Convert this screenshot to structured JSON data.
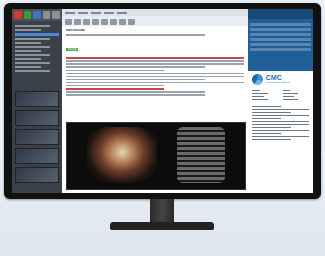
{
  "brand": {
    "logo_text": "CMC",
    "logo_subtitle": "Comprehensive Medical",
    "accent_color": "#1f66a9"
  },
  "report": {
    "section_label": "PROCEDURE",
    "highlight_label": "Normal",
    "highlight_color": "#4caf50"
  },
  "images": {
    "scan_left": "ct-chest-3d-render",
    "scan_right": "spine-sagittal-ct"
  },
  "icons": [
    "close-icon",
    "save-icon",
    "undo-icon",
    "redo-icon",
    "print-icon",
    "settings-icon"
  ]
}
